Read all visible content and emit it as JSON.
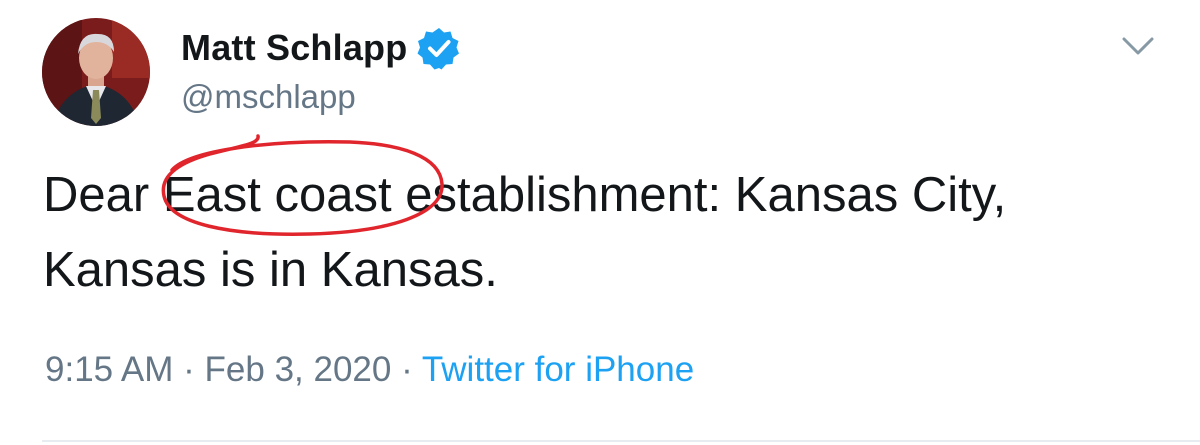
{
  "tweet": {
    "display_name": "Matt Schlapp",
    "handle": "@mschlapp",
    "verified": true,
    "text_before": "Dear ",
    "text_highlight": "East coast",
    "text_after": " establishment:  Kansas City, Kansas is in Kansas.",
    "time": "9:15 AM",
    "sep1": " · ",
    "date": "Feb 3, 2020",
    "sep2": " · ",
    "source": "Twitter for iPhone"
  },
  "icons": {
    "verified": "verified-badge-icon",
    "menu": "chevron-down-icon"
  },
  "colors": {
    "link": "#1da1f2",
    "secondary_text": "#657786",
    "annotation": "#e0252c"
  }
}
